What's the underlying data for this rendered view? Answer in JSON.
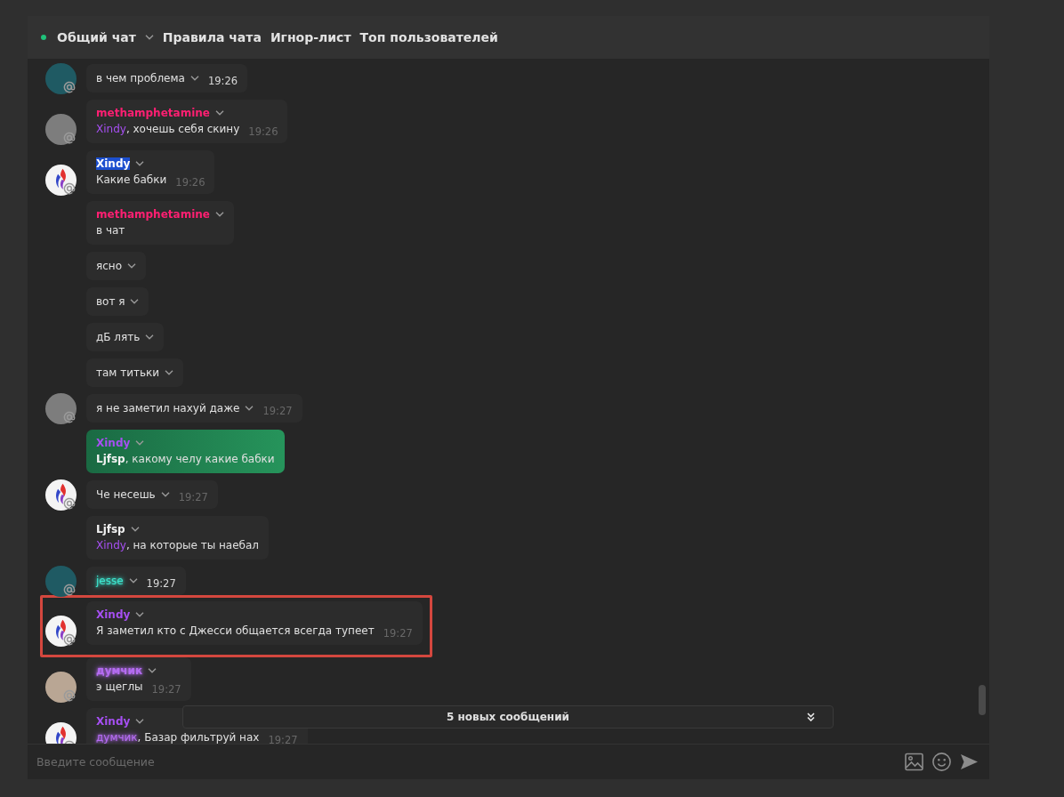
{
  "header": {
    "online": true,
    "channel": "Общий чат",
    "links": [
      "Правила чата",
      "Игнор-лист",
      "Топ пользователей"
    ]
  },
  "messages": [
    {
      "avatar": {
        "kind": "photo",
        "color": "#1f5a63"
      },
      "text": [
        {
          "kind": "plain",
          "text": "в чем проблема"
        }
      ],
      "time": "19:26",
      "time_bright": true,
      "own": false,
      "framed": false
    },
    {
      "avatar": {
        "kind": "photo",
        "color": "#7d7d7d"
      },
      "author": {
        "name": "methamphetamine",
        "kind": "plain",
        "color": "#ff1f72"
      },
      "text": [
        {
          "kind": "mention",
          "text": "Xindy",
          "color": "#a64ff2"
        },
        {
          "kind": "plain",
          "text": ", хочешь себя скину"
        }
      ],
      "time": "19:26",
      "time_bright": false,
      "own": false,
      "framed": false
    },
    {
      "avatar": {
        "kind": "logo"
      },
      "author": {
        "name": "Xindy",
        "kind": "selected"
      },
      "text": [
        {
          "kind": "plain",
          "text": "Какие бабки"
        }
      ],
      "time": "19:26",
      "time_bright": false,
      "own": false,
      "framed": false
    },
    {
      "author": {
        "name": "methamphetamine",
        "kind": "plain",
        "color": "#ff1f72"
      },
      "text": [
        {
          "kind": "plain",
          "text": "в чат"
        }
      ],
      "own": false,
      "framed": false
    },
    {
      "text": [
        {
          "kind": "plain",
          "text": "ясно"
        }
      ],
      "own": false,
      "framed": false
    },
    {
      "text": [
        {
          "kind": "plain",
          "text": "вот я"
        }
      ],
      "own": false,
      "framed": false
    },
    {
      "text": [
        {
          "kind": "plain",
          "text": "дБ лять"
        }
      ],
      "own": false,
      "framed": false
    },
    {
      "text": [
        {
          "kind": "plain",
          "text": "там титьки"
        }
      ],
      "own": false,
      "framed": false
    },
    {
      "avatar": {
        "kind": "photo",
        "color": "#7d7d7d"
      },
      "text": [
        {
          "kind": "plain",
          "text": "я не заметил нахуй даже"
        }
      ],
      "time": "19:27",
      "time_bright": false,
      "own": false,
      "framed": false
    },
    {
      "author": {
        "name": "Xindy",
        "kind": "plain",
        "color": "#a64ff2"
      },
      "text": [
        {
          "kind": "bold",
          "text": "Ljfsp"
        },
        {
          "kind": "plain",
          "text": ", какому челу какие бабки"
        }
      ],
      "own": true,
      "framed": false
    },
    {
      "avatar": {
        "kind": "logo"
      },
      "text": [
        {
          "kind": "plain",
          "text": "Че несешь"
        }
      ],
      "time": "19:27",
      "time_bright": false,
      "own": false,
      "framed": false
    },
    {
      "author": {
        "name": "Ljfsp",
        "kind": "plain",
        "color": "#f2f2f2"
      },
      "text": [
        {
          "kind": "mention",
          "text": "Xindy",
          "color": "#a64ff2"
        },
        {
          "kind": "plain",
          "text": ", на которые ты наебал"
        }
      ],
      "own": false,
      "framed": false
    },
    {
      "avatar": {
        "kind": "photo",
        "color": "#1f5a63"
      },
      "text": [
        {
          "kind": "glow",
          "text": "jesse",
          "color": "#3de6cf"
        }
      ],
      "time": "19:27",
      "time_bright": true,
      "own": false,
      "framed": false
    },
    {
      "avatar": {
        "kind": "logo"
      },
      "author": {
        "name": "Xindy",
        "kind": "plain",
        "color": "#a64ff2"
      },
      "text": [
        {
          "kind": "plain",
          "text": "Я заметил кто с Джесси общается всегда тупеет"
        }
      ],
      "time": "19:27",
      "time_bright": false,
      "own": false,
      "framed": true
    },
    {
      "avatar": {
        "kind": "photo",
        "color": "#b9a694"
      },
      "author": {
        "name": "думчик",
        "kind": "glow",
        "color": "#b56cf2"
      },
      "text": [
        {
          "kind": "plain",
          "text": "э щеглы"
        }
      ],
      "time": "19:27",
      "time_bright": false,
      "own": false,
      "framed": false
    },
    {
      "avatar": {
        "kind": "logo"
      },
      "author": {
        "name": "Xindy",
        "kind": "plain",
        "color": "#a64ff2"
      },
      "text": [
        {
          "kind": "glow",
          "text": "думчик",
          "color": "#b56cf2"
        },
        {
          "kind": "plain",
          "text": ", Базар фильтруй нах"
        }
      ],
      "time": "19:27",
      "time_bright": false,
      "own": false,
      "framed": false
    }
  ],
  "new_messages": {
    "label": "5 новых сообщений"
  },
  "composer": {
    "placeholder": "Введите сообщение"
  }
}
